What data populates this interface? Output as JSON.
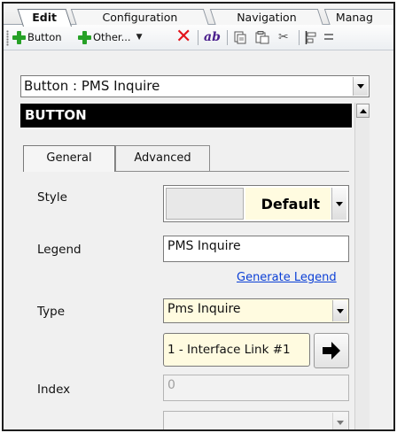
{
  "ribbon": {
    "tabs": [
      {
        "label": "Edit",
        "active": true
      },
      {
        "label": "Configuration",
        "active": false
      },
      {
        "label": "Navigation",
        "active": false
      },
      {
        "label": "Manag",
        "active": false
      }
    ]
  },
  "toolbar": {
    "add_button_label": "Button",
    "add_other_label": "Other...",
    "icons": [
      "green-plus",
      "red-x",
      "ab-text",
      "copy",
      "paste",
      "cut",
      "align-left"
    ]
  },
  "inspector": {
    "object_selector": "Button : PMS Inquire",
    "header": "BUTTON",
    "tabs": [
      {
        "label": "General",
        "active": true
      },
      {
        "label": "Advanced",
        "active": false
      }
    ],
    "fields": {
      "style": {
        "label": "Style",
        "value": "Default"
      },
      "legend": {
        "label": "Legend",
        "value": "PMS Inquire"
      },
      "generate_legend_link": "Generate Legend",
      "type": {
        "label": "Type",
        "value": "Pms Inquire"
      },
      "interface_link": "1 - Interface Link #1",
      "index": {
        "label": "Index",
        "value": "0"
      },
      "extra_select": ""
    }
  },
  "colors": {
    "header_bar": "#000000",
    "link": "#0b3fd6",
    "field_highlight": "#fffbe0",
    "add_icon": "#27a127",
    "delete_icon": "#e3141b"
  }
}
